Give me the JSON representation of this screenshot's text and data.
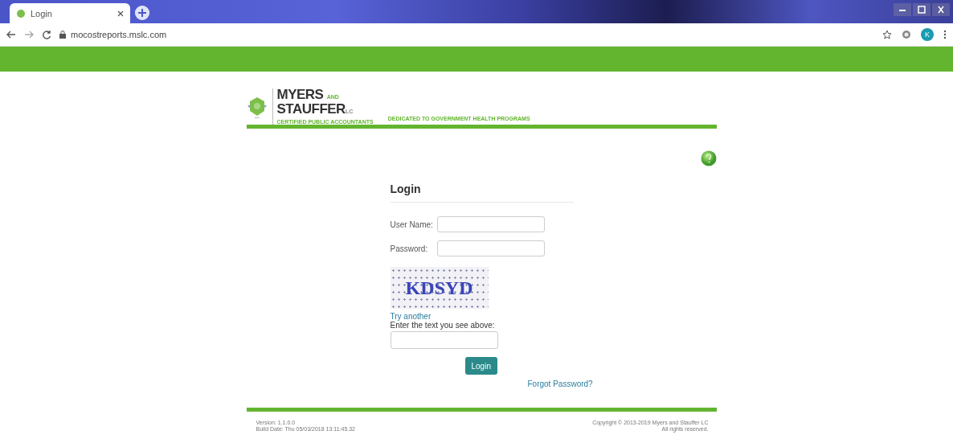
{
  "browser": {
    "tab_title": "Login",
    "url": "mocostreports.mslc.com",
    "profile_initial": "K"
  },
  "header": {
    "brand_line1": "MYERS",
    "brand_and": "AND",
    "brand_line2": "STAUFFER",
    "brand_suffix": "LC",
    "brand_tagline": "CERTIFIED PUBLIC ACCOUNTANTS",
    "slogan": "DEDICATED TO GOVERNMENT HEALTH PROGRAMS"
  },
  "login": {
    "title": "Login",
    "fields": [
      {
        "label": "User Name:"
      },
      {
        "label": "Password:"
      }
    ],
    "captcha_text": "KDSYD",
    "try_another": "Try another",
    "captcha_prompt": "Enter the text you see above:",
    "submit": "Login",
    "forgot": "Forgot Password?"
  },
  "footer": {
    "version": "Version: 1.1.0.0",
    "build_date": "Build Date: Thu 05/03/2018 13:11:45.32",
    "copyright": "Copyright © 2013-2019 Myers and Stauffer LC",
    "rights": "All rights reserved."
  }
}
